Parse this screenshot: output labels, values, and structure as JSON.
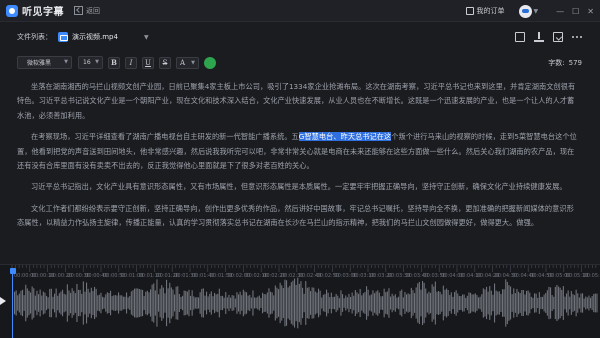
{
  "app": {
    "logo_text": "听见字幕",
    "back_label": "返回",
    "orders_label": "我的订单",
    "window_controls": [
      "—",
      "☐",
      "✕"
    ]
  },
  "file": {
    "label": "文件列表：",
    "current_file": "演示视频.mp4",
    "icons": [
      "folder-icon",
      "chevron-down-icon",
      "print-icon",
      "save-icon",
      "download-icon",
      "more-icon"
    ]
  },
  "toolbar": {
    "font_family": "微软雅黑",
    "font_size": "16",
    "bold": "B",
    "italic": "I",
    "underline": "U",
    "strike": "S",
    "color_label": "A",
    "wordcount_label": "字数:",
    "wordcount_value": "579",
    "colors": {
      "accent": "#3d8bff",
      "color_dot": "#2ea44f",
      "highlight": "#2f6fe0"
    }
  },
  "editor": {
    "paragraphs": [
      {
        "text": "坐落在湖南湘西的马拦山视频文创产业园，日前已聚集4家主板上市公司，吸引了1334家企业抢滩布局。这次在湖南考察，习近平总书记也来到这里，并肯定湖南文创很有特色。习近平总书记说文化产业是一个朝阳产业，现在文化和技术深入结合，文化产业快速发展，从业人员也在不断增长。这既是一个迅速发展的产业，也是一个让人的人才蓄水池，必须善加利用。",
        "highlight": ""
      },
      {
        "text_before": "在考察现场，习近平详细查看了湖南广播电视台自主研发的新一代智能广播系统。五",
        "highlight": "G智慧电台、昨天总书记在这",
        "text_after": "个叛个进行马来山的视察的时候，走到5菜智慧电台这个位置，他看到把党的声音送到田间地头，他非常感兴趣，然后说我我听完可以吧，非常非常关心就是电商在未来还能够在这些方面做一些什么。然后关心我们湖南的农产品，现在还有没有合库里面有没有卖卖不出去的，反正我觉得他心里面就是下了很多对老百姓的关心。"
      },
      {
        "text": "习近平总书记指出，文化产业具有意识形态属性，又有市场属性，但意识形态属性是本质属性。一定要牢牢把握正确导向，坚持守正创新，确保文化产业持续健康发展。",
        "highlight": ""
      },
      {
        "text": "文化工作者们都纷纷表示要守正创新，坚持正确导向，创作出更多优秀的作品，然后讲好中国故事，牢记总书记嘱托，坚持导向全不换，更加准确的把握新闻媒体的意识形态属性，以精益力作弘扬主旋律，传播正能量，认真的学习贯彻落实总书记在湖南在长沙在马拦山的指示精神，把我们的马拦山文创园做得更好，做得更大。做强。",
        "highlight": ""
      }
    ]
  },
  "timeline": {
    "tick_labels": [
      "00:00:00",
      "00:00:10",
      "00:00:20",
      "00:00:30",
      "00:00:40",
      "00:00:50",
      "00:01:00",
      "00:01:10",
      "00:01:20",
      "00:01:30",
      "00:01:40",
      "00:01:50",
      "00:02:00",
      "00:02:10",
      "00:02:20",
      "00:02:30",
      "00:02:40",
      "00:02:50",
      "00:03:00",
      "00:03:10",
      "00:03:20",
      "00:03:30",
      "00:03:40",
      "00:03:50",
      "00:04:00",
      "00:04:10",
      "00:04:20",
      "00:04:30",
      "00:04:40",
      "00:04:50",
      "00:05:00",
      "00:05:10",
      "00:05:20"
    ],
    "playhead_icon": "play-icon"
  }
}
